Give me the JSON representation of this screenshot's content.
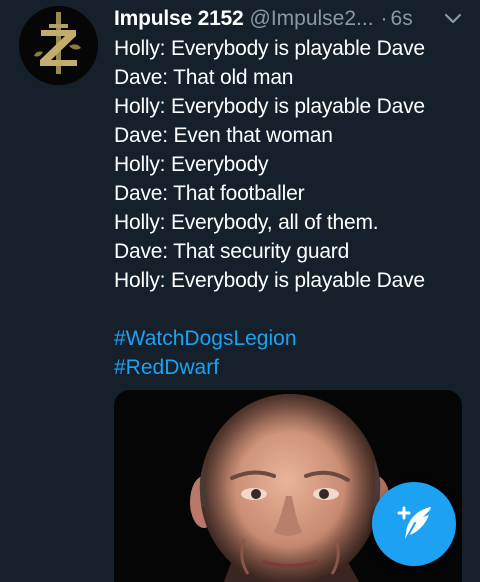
{
  "tweet": {
    "author_name": "Impulse 2152",
    "author_handle": "@Impulse2...",
    "separator": "·",
    "timestamp": "6s",
    "lines": [
      "Holly: Everybody is playable Dave",
      "Dave: That old man",
      "Holly: Everybody is playable Dave",
      "Dave: Even that woman",
      "Holly: Everybody",
      "Dave: That footballer",
      "Holly: Everybody, all of them.",
      "Dave: That security guard",
      "Holly: Everybody is playable Dave"
    ],
    "hashtags": [
      "#WatchDogsLegion",
      "#RedDwarf"
    ],
    "avatar_icon": "zelda-emblem-icon",
    "media_icon": "photo-of-bald-man"
  },
  "fab": {
    "icon": "compose-feather-icon"
  },
  "colors": {
    "background": "#15202b",
    "text": "#ffffff",
    "secondary": "#8899a6",
    "accent": "#1da1f2"
  }
}
